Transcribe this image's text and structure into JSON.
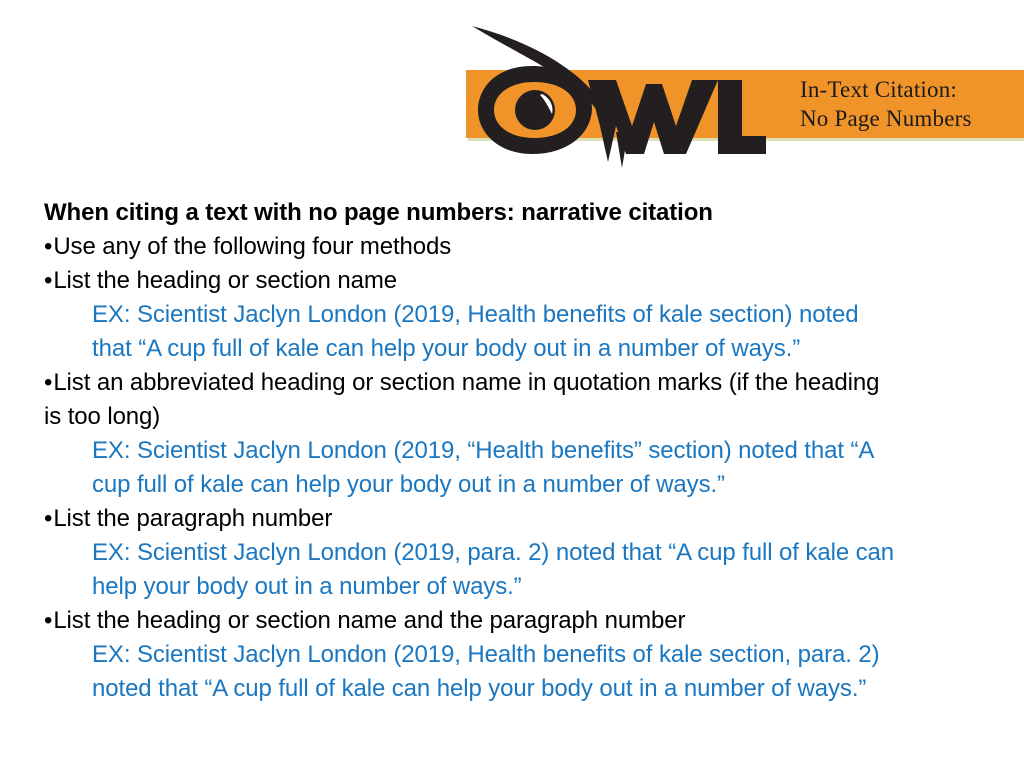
{
  "slide": {
    "background_color": "#FFFFFF",
    "accent_orange": "#F0942A",
    "accent_blue": "#1B77C0",
    "text_color": "#000000"
  },
  "header": {
    "logo_text": "OWL",
    "logo_icon": "owl-eye-logo",
    "banner_color": "#F0942A",
    "title_line_1": "In-Text Citation:",
    "title_line_2": "No Page Numbers"
  },
  "body": {
    "heading": "When citing a text with no page numbers: narrative citation",
    "bullet_glyph": "•",
    "lines": [
      {
        "id": "bullet-use-any",
        "kind": "bullet",
        "text": "Use any of the following four methods"
      },
      {
        "id": "bullet-list-heading",
        "kind": "bullet",
        "text": "List the heading or section name"
      },
      {
        "id": "ex-1-line-1",
        "kind": "ex",
        "text": "EX: Scientist Jaclyn London (2019, Health benefits of kale section) noted"
      },
      {
        "id": "ex-1-line-2",
        "kind": "ex-cont",
        "text": "that “A cup full of kale can help your body out in a number of ways.”"
      },
      {
        "id": "bullet-abbreviated",
        "kind": "bullet",
        "text": "List an abbreviated heading or section name in quotation marks (if the heading"
      },
      {
        "id": "bullet-abbreviated-cont",
        "kind": "cont",
        "text": "is too long)"
      },
      {
        "id": "ex-2-line-1",
        "kind": "ex",
        "text": "EX: Scientist Jaclyn London (2019, “Health benefits” section) noted that “A"
      },
      {
        "id": "ex-2-line-2",
        "kind": "ex-cont",
        "text": "cup full of kale can help your body out in a number of ways.”"
      },
      {
        "id": "bullet-paragraph-number",
        "kind": "bullet",
        "text": "List the paragraph number"
      },
      {
        "id": "ex-3-line-1",
        "kind": "ex",
        "text": "EX: Scientist Jaclyn London (2019, para. 2) noted that “A cup full of kale can"
      },
      {
        "id": "ex-3-line-2",
        "kind": "ex-cont",
        "text": "help your body out in a number of ways.”"
      },
      {
        "id": "bullet-heading-and-paragraph",
        "kind": "bullet",
        "text": "List the heading or section name and the paragraph number"
      },
      {
        "id": "ex-4-line-1",
        "kind": "ex",
        "text": "EX: Scientist Jaclyn London (2019, Health benefits of kale section, para. 2)"
      },
      {
        "id": "ex-4-line-2",
        "kind": "ex-cont",
        "text": "noted that “A cup full of kale can help your body out in a number of ways.”"
      }
    ]
  }
}
